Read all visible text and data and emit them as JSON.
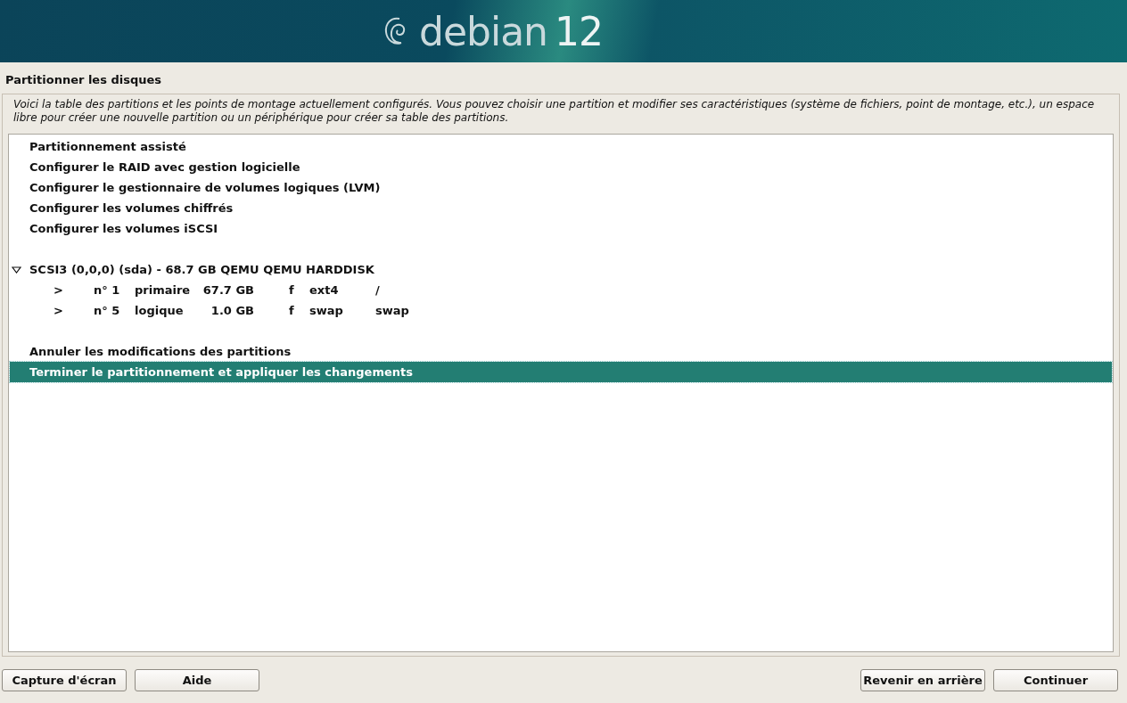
{
  "banner": {
    "logo_text": "debian",
    "version": "12"
  },
  "title": "Partitionner les disques",
  "description": "Voici la table des partitions et les points de montage actuellement configurés. Vous pouvez choisir une partition et modifier ses caractéristiques (système de fichiers, point de montage, etc.), un espace libre pour créer une nouvelle partition ou un périphérique pour créer sa table des partitions.",
  "groups": [
    {
      "items": [
        {
          "kind": "action",
          "label": "Partitionnement assisté",
          "selected": false
        },
        {
          "kind": "action",
          "label": "Configurer le RAID avec gestion logicielle",
          "selected": false
        },
        {
          "kind": "action",
          "label": "Configurer le gestionnaire de volumes logiques (LVM)",
          "selected": false
        },
        {
          "kind": "action",
          "label": "Configurer les volumes chiffrés",
          "selected": false
        },
        {
          "kind": "action",
          "label": "Configurer les volumes iSCSI",
          "selected": false
        }
      ]
    },
    {
      "items": [
        {
          "kind": "disk",
          "label": "SCSI3 (0,0,0) (sda) - 68.7 GB QEMU QEMU HARDDISK",
          "selected": false,
          "expanded": true,
          "children": [
            {
              "kind": "partition",
              "marker": ">",
              "number": "n° 1",
              "type": "primaire",
              "size": "67.7 GB",
              "flag": "f",
              "filesystem": "ext4",
              "mount": "/",
              "selected": false
            },
            {
              "kind": "partition",
              "marker": ">",
              "number": "n° 5",
              "type": "logique",
              "size": "1.0 GB",
              "flag": "f",
              "filesystem": "swap",
              "mount": "swap",
              "selected": false
            }
          ]
        }
      ]
    },
    {
      "items": [
        {
          "kind": "action",
          "label": "Annuler les modifications des partitions",
          "selected": false
        },
        {
          "kind": "action",
          "label": "Terminer le partitionnement et appliquer les changements",
          "selected": true
        }
      ]
    }
  ],
  "buttons_left": [
    "Capture d'écran",
    "Aide"
  ],
  "buttons_right": [
    "Revenir en arrière",
    "Continuer"
  ]
}
